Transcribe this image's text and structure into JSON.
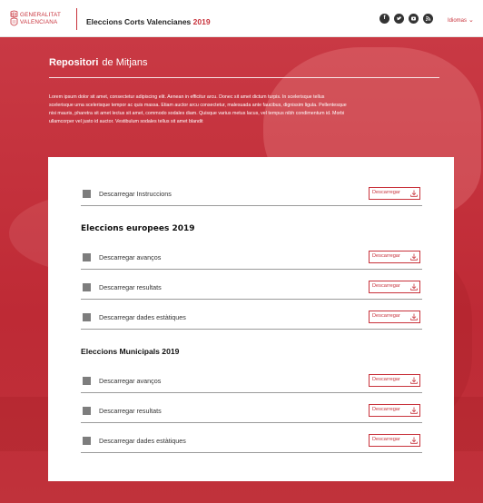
{
  "header": {
    "logo_lines": [
      "GENERALITAT",
      "VALENCIANA"
    ],
    "title": "Eleccions Corts Valencianes",
    "title_year": "2019",
    "social_icons": [
      "facebook-icon",
      "twitter-icon",
      "youtube-icon",
      "rss-icon"
    ],
    "language_label": "Idiomas"
  },
  "hero": {
    "title_strong": "Repositori",
    "title_rest": "de Mitjans",
    "intro": "Lorem ipsum dolor sit amet, consectetur adipiscing elit. Aenean in efficitur arcu. Donec sit amet dictum turpis. In scelerisque tellus scelerisque urna scelerisque tempor ac quis massa. Etiam auctor arcu consectetur, malesuada ante faucibus, dignissim ligula. Pellentesque nisi mauris, pharetra sit amet lectus sit amet, commodo sodales diam. Quisque varius metus lacus, vel tempus nibh condimentum id. Morbi ullamcorper vel justo id auctor. Vestibulum sodales tellus sit amet blandit"
  },
  "repository": {
    "download_label": "Descarregar",
    "instructions": "Descarregar Instruccions",
    "sections": [
      {
        "title": "Eleccions europees 2019",
        "items": [
          "Descarregar avanços",
          "Descarregar resultats",
          "Descarregar dades estàtiques"
        ]
      },
      {
        "title": "Eleccions Municipals 2019",
        "items": [
          "Descarregar avanços",
          "Descarregar resultats",
          "Descarregar dades estàtiques"
        ]
      }
    ]
  },
  "colors": {
    "brand_red": "#c8323b",
    "header_bg": "#ffffff",
    "card_bg": "#ffffff"
  }
}
